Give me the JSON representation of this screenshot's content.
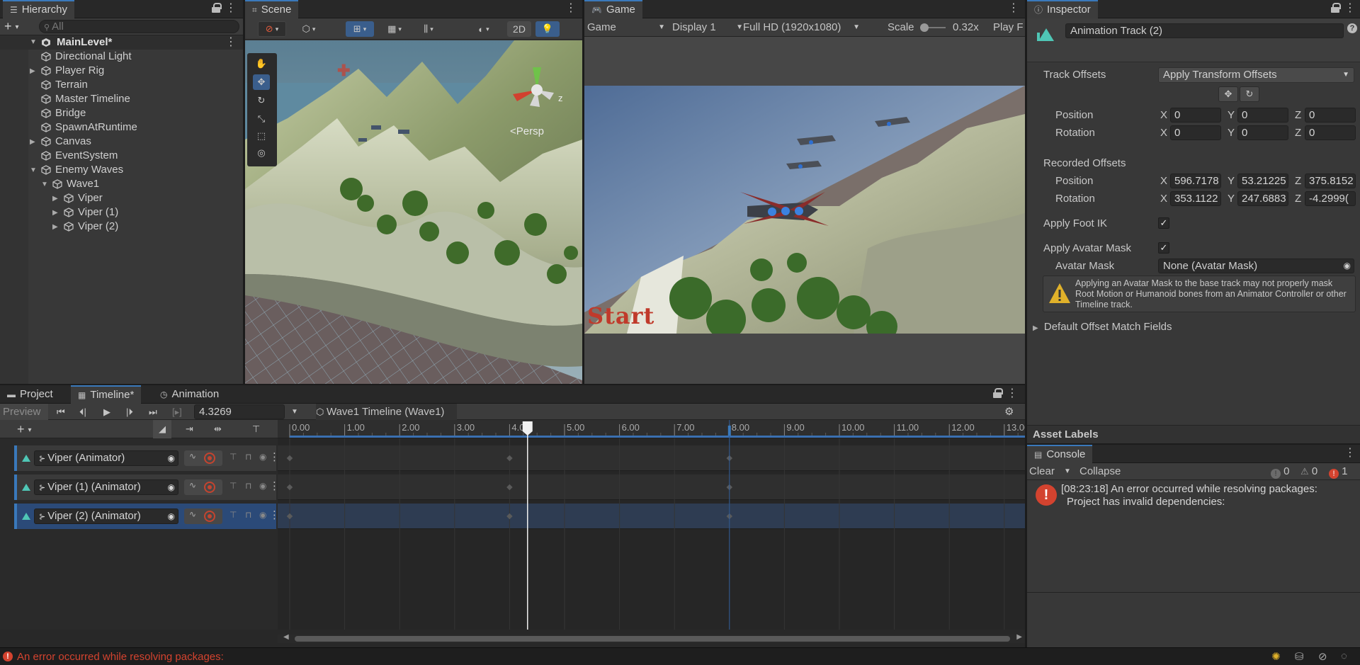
{
  "hierarchy": {
    "tab_label": "Hierarchy",
    "search_placeholder": "All",
    "scene_name": "MainLevel*",
    "items": [
      {
        "label": "Directional Light"
      },
      {
        "label": "Player Rig"
      },
      {
        "label": "Terrain"
      },
      {
        "label": "Master Timeline"
      },
      {
        "label": "Bridge"
      },
      {
        "label": "SpawnAtRuntime"
      },
      {
        "label": "Canvas"
      },
      {
        "label": "EventSystem"
      },
      {
        "label": "Enemy Waves"
      },
      {
        "label": "Wave1"
      },
      {
        "label": "Viper"
      },
      {
        "label": "Viper (1)"
      },
      {
        "label": "Viper (2)"
      }
    ]
  },
  "scene": {
    "tab_label": "Scene",
    "btn_2d": "2D",
    "persp_label": "Persp",
    "gizmo_axis_label": "z"
  },
  "game": {
    "tab_label": "Game",
    "view_select": "Game",
    "display_select": "Display 1",
    "resolution_select": "Full HD (1920x1080)",
    "scale_label": "Scale",
    "scale_value": "0.32x",
    "play_label": "Play F",
    "overlay_text": "Start"
  },
  "inspector": {
    "tab_label": "Inspector",
    "object_name": "Animation Track (2)",
    "track_offsets_label": "Track Offsets",
    "track_offsets_value": "Apply Transform Offsets",
    "position_label": "Position",
    "rotation_label": "Rotation",
    "position": {
      "x": "0",
      "y": "0",
      "z": "0"
    },
    "rotation": {
      "x": "0",
      "y": "0",
      "z": "0"
    },
    "recorded_offsets_label": "Recorded Offsets",
    "recorded_position": {
      "x": "596.7178",
      "y": "53.21225",
      "z": "375.8152"
    },
    "recorded_rotation": {
      "x": "353.1122",
      "y": "247.6883",
      "z": "-4.2999("
    },
    "axis_x": "X",
    "axis_y": "Y",
    "axis_z": "Z",
    "apply_foot_ik_label": "Apply Foot IK",
    "apply_avatar_mask_label": "Apply Avatar Mask",
    "avatar_mask_label": "Avatar Mask",
    "avatar_mask_value": "None (Avatar Mask)",
    "warning_text": "Applying an Avatar Mask to the base track may not properly mask Root Motion or Humanoid bones from an Animator Controller or other Timeline track.",
    "default_offset_label": "Default Offset Match Fields",
    "asset_labels": "Asset Labels"
  },
  "bottom_tabs": {
    "project": "Project",
    "timeline": "Timeline*",
    "animation": "Animation"
  },
  "timeline": {
    "preview_label": "Preview",
    "time_value": "4.3269",
    "asset_name": "Wave1 Timeline (Wave1)",
    "playhead_time": 4.3269,
    "marker_time": 8.0,
    "ruler_labels": [
      "0.00",
      "1.00",
      "2.00",
      "3.00",
      "4.00",
      "5.00",
      "6.00",
      "7.00",
      "8.00",
      "9.00",
      "10.00",
      "11.00",
      "12.00",
      "13.00"
    ],
    "tracks": [
      {
        "label": "Viper (Animator)",
        "selected": false
      },
      {
        "label": "Viper (1) (Animator)",
        "selected": false
      },
      {
        "label": "Viper (2) (Animator)",
        "selected": true
      }
    ],
    "keyframe_times": [
      0.0,
      4.0,
      8.0
    ]
  },
  "console": {
    "tab_label": "Console",
    "clear_label": "Clear",
    "collapse_label": "Collapse",
    "info_count": "0",
    "warn_count": "0",
    "error_count": "1",
    "message_line1": "[08:23:18] An error occurred while resolving packages:",
    "message_line2": "Project has invalid dependencies:"
  },
  "status_bar": {
    "message": "An error occurred while resolving packages:"
  },
  "colors": {
    "accent": "#3a79bb",
    "error": "#d3432f",
    "warning": "#e0b12a",
    "track_teal": "#4fc6b5"
  }
}
